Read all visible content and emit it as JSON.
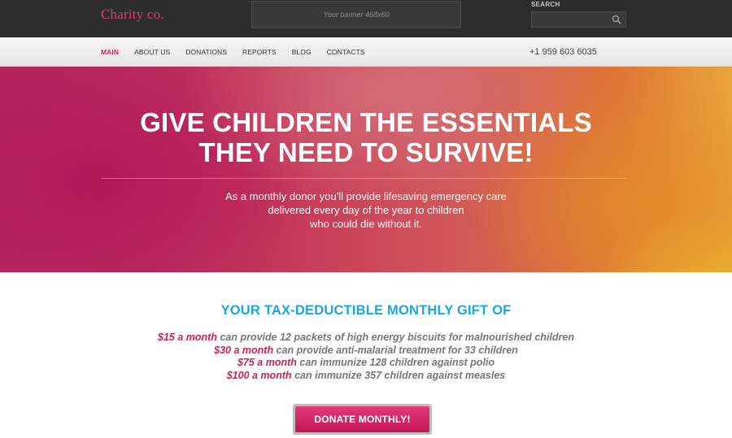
{
  "header": {
    "logo": "Charity co.",
    "banner_text": "Your banner 468x60",
    "search_label": "SEARCH",
    "search_placeholder": ""
  },
  "nav": {
    "items": [
      "MAIN",
      "ABOUT US",
      "DONATIONS",
      "REPORTS",
      "BLOG",
      "CONTACTS"
    ],
    "active": "MAIN",
    "phone": "+1 959 603 6035"
  },
  "hero": {
    "title_line1": "GIVE CHILDREN THE ESSENTIALS",
    "title_line2": "THEY NEED TO SURVIVE!",
    "text_line1": "As a monthly donor you'll provide lifesaving emergency care",
    "text_line2": "delivered every day of the year to children",
    "text_line3": "who could die without it."
  },
  "gift": {
    "title": "YOUR TAX-DEDUCTIBLE MONTHLY GIFT OF",
    "items": [
      {
        "amount": "$15 a month",
        "text": " can provide 12 packets of high energy biscuits for malnourished children"
      },
      {
        "amount": "$30 a month",
        "text": " can provide anti-malarial treatment for 33 children"
      },
      {
        "amount": "$75 a month",
        "text": " can immunize 128 children against polio"
      },
      {
        "amount": "$100 a month",
        "text": " can immunize 357 children against measles"
      }
    ]
  },
  "cta": {
    "label": "DONATE MONTHLY!"
  },
  "colors": {
    "brand_pink": "#d2245f",
    "accent_blue": "#1ba6e2",
    "topbar": "#2d2d2d"
  }
}
